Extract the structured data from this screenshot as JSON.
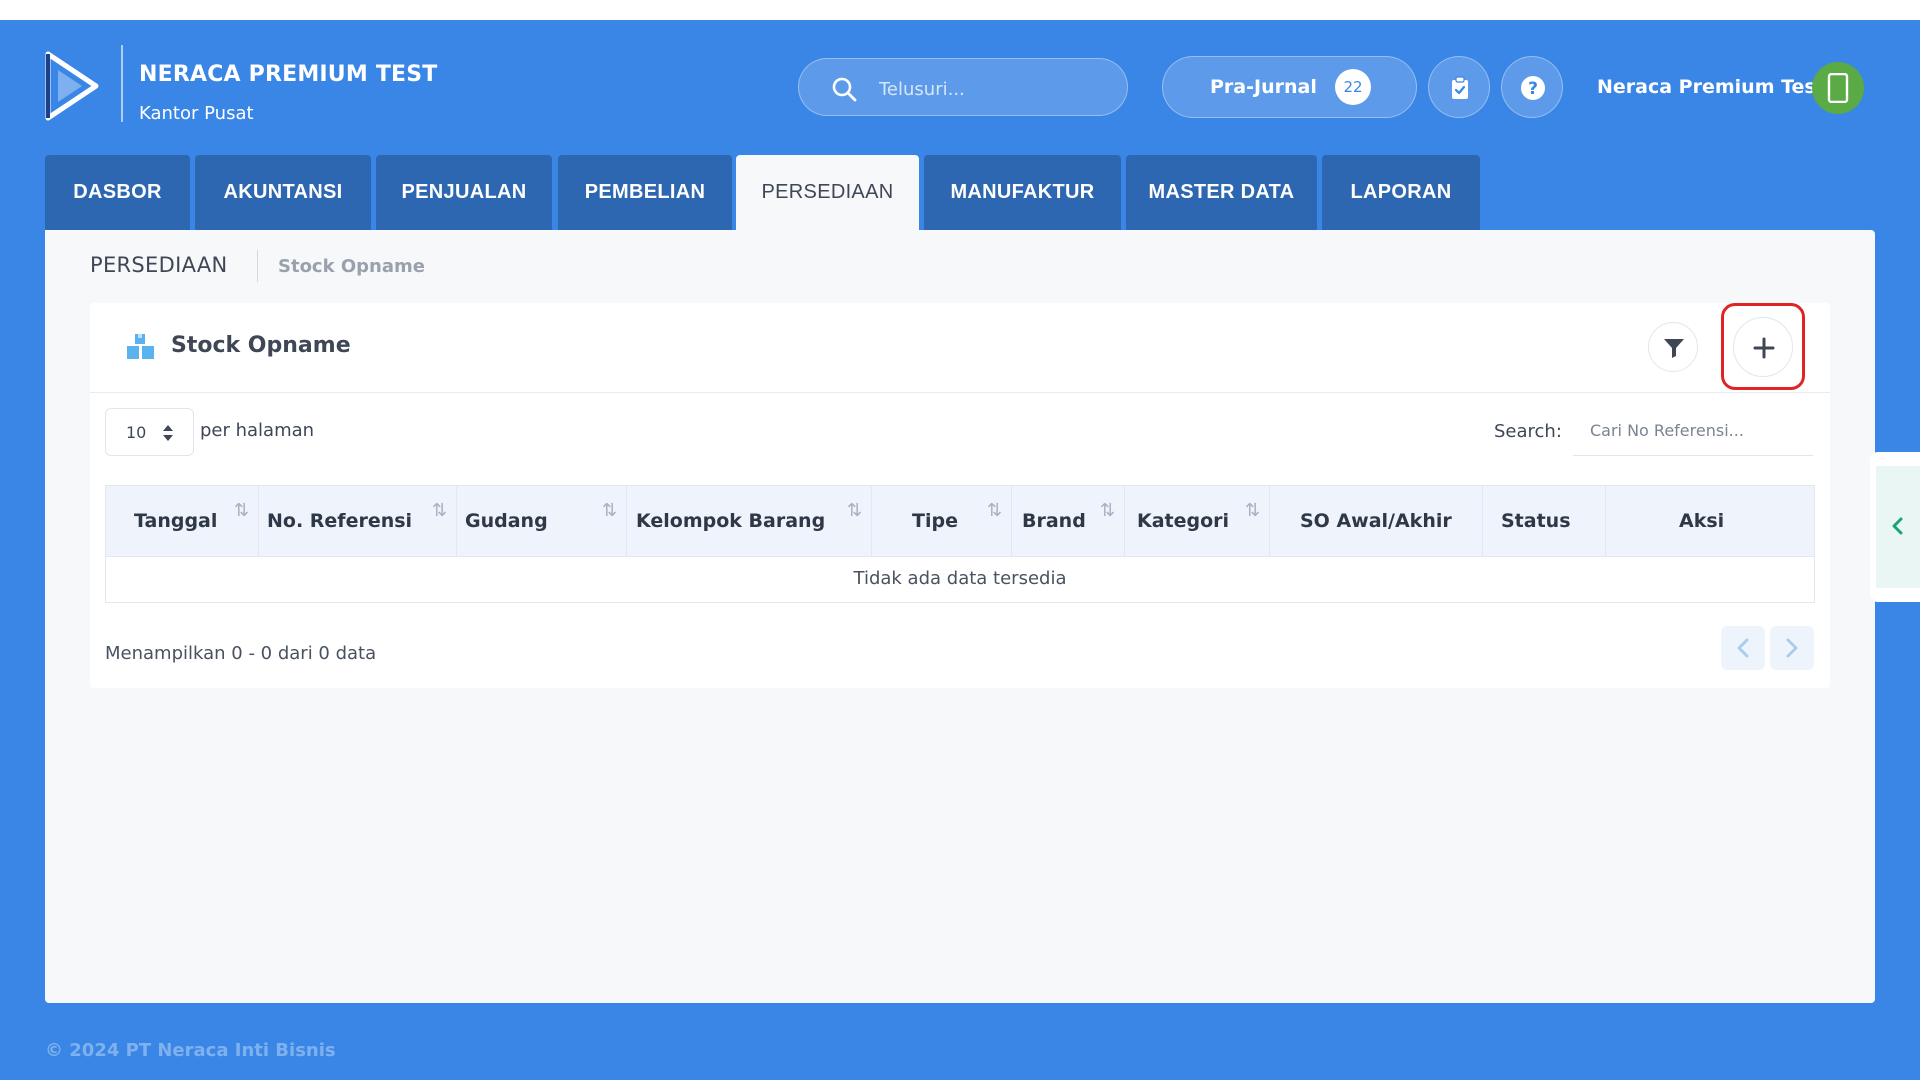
{
  "app": {
    "company_name": "NERACA PREMIUM TEST",
    "branch": "Kantor Pusat"
  },
  "header": {
    "search_placeholder": "Telusuri...",
    "prajurnal_label": "Pra-Jurnal",
    "prajurnal_count": "22",
    "user_name": "Neraca Premium Test",
    "icons": [
      "search-icon",
      "clipboard-check-icon",
      "help-icon",
      "mobile-phone-icon"
    ]
  },
  "tabs": [
    {
      "label": "DASBOR",
      "active": false
    },
    {
      "label": "AKUNTANSI",
      "active": false
    },
    {
      "label": "PENJUALAN",
      "active": false
    },
    {
      "label": "PEMBELIAN",
      "active": false
    },
    {
      "label": "PERSEDIAAN",
      "active": true
    },
    {
      "label": "MANUFAKTUR",
      "active": false
    },
    {
      "label": "MASTER DATA",
      "active": false
    },
    {
      "label": "LAPORAN",
      "active": false
    }
  ],
  "breadcrumb": {
    "section": "PERSEDIAAN",
    "page": "Stock Opname"
  },
  "panel": {
    "title": "Stock Opname",
    "per_page_value": "10",
    "per_page_label": "per halaman",
    "search_label": "Search:",
    "search_placeholder": "Cari No Referensi..."
  },
  "table": {
    "columns": [
      "Tanggal",
      "No. Referensi",
      "Gudang",
      "Kelompok Barang",
      "Tipe",
      "Brand",
      "Kategori",
      "SO Awal/Akhir",
      "Status",
      "Aksi"
    ],
    "empty_text": "Tidak ada data tersedia",
    "rows": []
  },
  "pagination": {
    "info": "Menampilkan 0 - 0 dari 0 data"
  },
  "footer": {
    "copyright": "© 2024 PT Neraca Inti Bisnis"
  },
  "colors": {
    "background": "#3a86e6",
    "tab": "#2e67b1",
    "highlight": "#e02424",
    "avatar": "#5aaa45"
  }
}
